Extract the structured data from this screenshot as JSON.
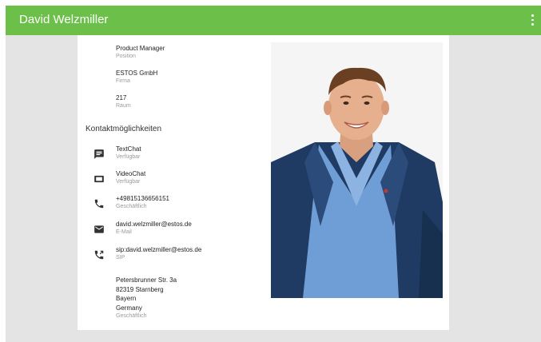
{
  "header": {
    "title": "David Welzmiller",
    "menu_icon": "more-vert-icon"
  },
  "details": [
    {
      "value": "Product Manager",
      "label": "Position"
    },
    {
      "value": "ESTOS GmbH",
      "label": "Firma"
    },
    {
      "value": "217",
      "label": "Raum"
    }
  ],
  "contact": {
    "title": "Kontaktmöglichkeiten",
    "items": [
      {
        "icon": "chat-icon",
        "value": "TextChat",
        "label": "Verfügbar"
      },
      {
        "icon": "videocam-icon",
        "value": "VideoChat",
        "label": "Verfügbar"
      },
      {
        "icon": "phone-icon",
        "value": "+49815136656151",
        "label": "Geschäftlich"
      },
      {
        "icon": "email-icon",
        "value": "david.welzmiller@estos.de",
        "label": "E-Mail"
      },
      {
        "icon": "sip-call-icon",
        "value": "sip:david.welzmiller@estos.de",
        "label": "SIP"
      }
    ]
  },
  "address": {
    "street": "Petersbrunner Str. 3a",
    "city": "82319 Starnberg",
    "state": "Bayern",
    "country": "Germany",
    "label": "Geschäftlich"
  },
  "colors": {
    "appbar": "#6cc04a",
    "background": "#e4e4e4",
    "card": "#ffffff",
    "icon": "#333333"
  }
}
